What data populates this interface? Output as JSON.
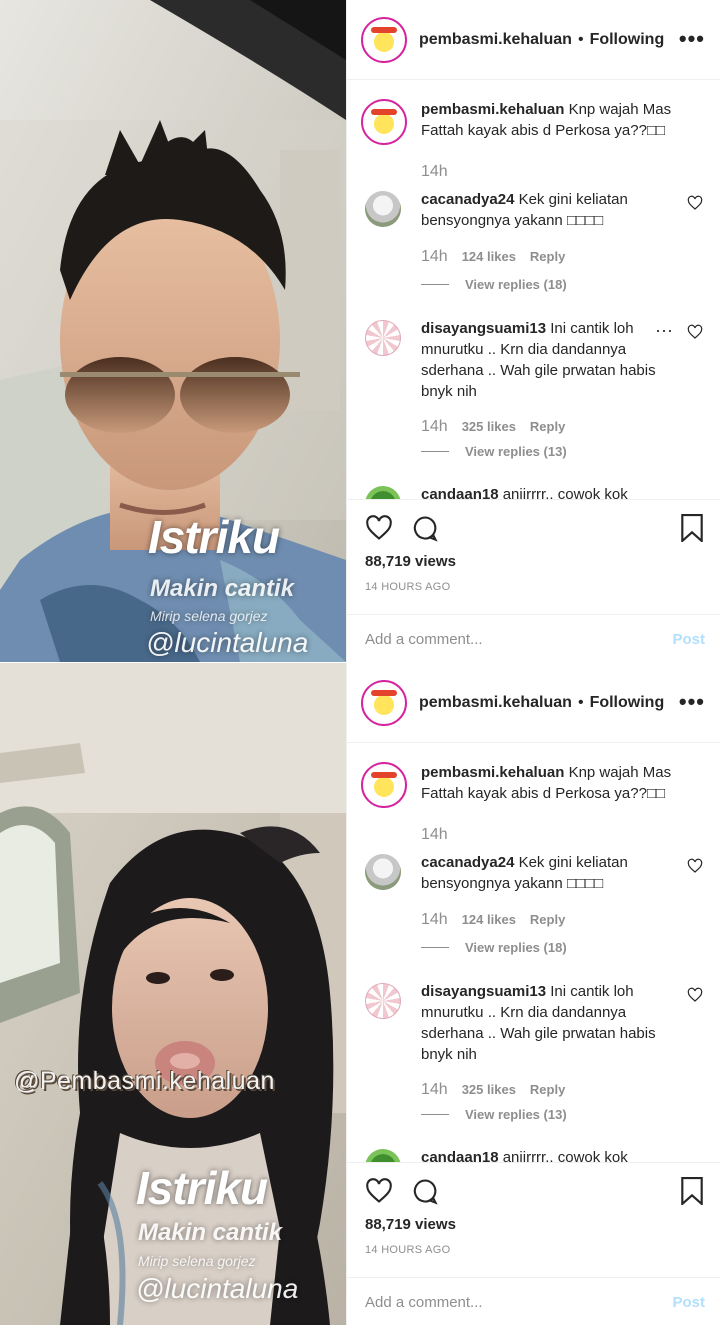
{
  "posts": [
    {
      "overlay": {
        "headline": "Istriku",
        "subtitle": "Makin cantik",
        "small": "Mirip selena gorjez",
        "tag": "@lucintaluna"
      },
      "header": {
        "username": "pembasmi.kehaluan",
        "separator": "•",
        "follow": "Following",
        "more": "•••"
      },
      "caption": {
        "username": "pembasmi.kehaluan",
        "text": "Knp wajah Mas Fattah kayak abis d Perkosa ya??□□",
        "time": "14h"
      },
      "comments": [
        {
          "username": "cacanadya24",
          "text": "Kek gini keliatan bensyongnya yakann □□□□",
          "time": "14h",
          "likes": "124 likes",
          "reply": "Reply",
          "view_replies": "View replies (18)"
        },
        {
          "username": "disayangsuami13",
          "text": "Ini cantik loh mnurutku .. Krn dia dandannya sderhana .. Wah gile prwatan habis bnyk nih",
          "time": "14h",
          "likes": "325 likes",
          "reply": "Reply",
          "view_replies": "View replies (13)",
          "more": "···"
        },
        {
          "username": "candaan18",
          "text": "anjirrrr.. cowok kok"
        }
      ],
      "views": "88,719 views",
      "ago": "14 HOURS AGO",
      "add_comment_placeholder": "Add a comment...",
      "post_label": "Post"
    },
    {
      "overlay": {
        "watermark": "@Pembasmi.kehaluan",
        "headline": "Istriku",
        "subtitle": "Makin cantik",
        "small": "Mirip selena gorjez",
        "tag": "@lucintaluna"
      },
      "header": {
        "username": "pembasmi.kehaluan",
        "separator": "•",
        "follow": "Following",
        "more": "•••"
      },
      "caption": {
        "username": "pembasmi.kehaluan",
        "text": "Knp wajah Mas Fattah kayak abis d Perkosa ya??□□",
        "time": "14h"
      },
      "comments": [
        {
          "username": "cacanadya24",
          "text": "Kek gini keliatan bensyongnya yakann □□□□",
          "time": "14h",
          "likes": "124 likes",
          "reply": "Reply",
          "view_replies": "View replies (18)"
        },
        {
          "username": "disayangsuami13",
          "text": "Ini cantik loh mnurutku .. Krn dia dandannya sderhana .. Wah gile prwatan habis bnyk nih",
          "time": "14h",
          "likes": "325 likes",
          "reply": "Reply",
          "view_replies": "View replies (13)"
        },
        {
          "username": "candaan18",
          "text": "anjirrrr.. cowok kok"
        }
      ],
      "views": "88,719 views",
      "ago": "14 HOURS AGO",
      "add_comment_placeholder": "Add a comment...",
      "post_label": "Post"
    }
  ],
  "icons": {
    "heart": "heart-icon",
    "comment": "comment-icon",
    "bookmark": "bookmark-icon",
    "more": "more-options-icon"
  },
  "colors": {
    "link_blue_disabled": "#b2dffc",
    "muted": "#8e8e8e",
    "text": "#262626",
    "border": "#efefef",
    "ring": "#d6249f"
  }
}
